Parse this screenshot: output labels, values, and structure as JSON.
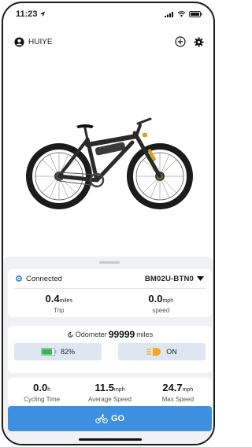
{
  "status_bar": {
    "time": "11:23"
  },
  "header": {
    "username": "HUIYE"
  },
  "connection": {
    "status": "Connected",
    "device": "BM02U-BTN0"
  },
  "ride": {
    "trip": {
      "value": "0.4",
      "unit": "miles",
      "label": "Trip"
    },
    "speed": {
      "value": "0.0",
      "unit": "mph",
      "label": "speed"
    }
  },
  "odometer": {
    "label": "Odometer",
    "value": "99999",
    "unit": "miles"
  },
  "battery": {
    "percent_text": "82%",
    "level": 0.82
  },
  "light": {
    "state": "ON"
  },
  "summary": {
    "cycling_time": {
      "value": "0.0",
      "unit": "h",
      "label": "Cycling Time"
    },
    "average_speed": {
      "value": "11.5",
      "unit": "mph",
      "label": "Average Speed"
    },
    "max_speed": {
      "value": "24.7",
      "unit": "mph",
      "label": "Max Speed"
    }
  },
  "go_button": {
    "label": "GO"
  },
  "colors": {
    "accent": "#3d8fe0",
    "pill_bg": "#dde6f1",
    "battery_green": "#35b84a",
    "light_orange": "#f5a623"
  }
}
